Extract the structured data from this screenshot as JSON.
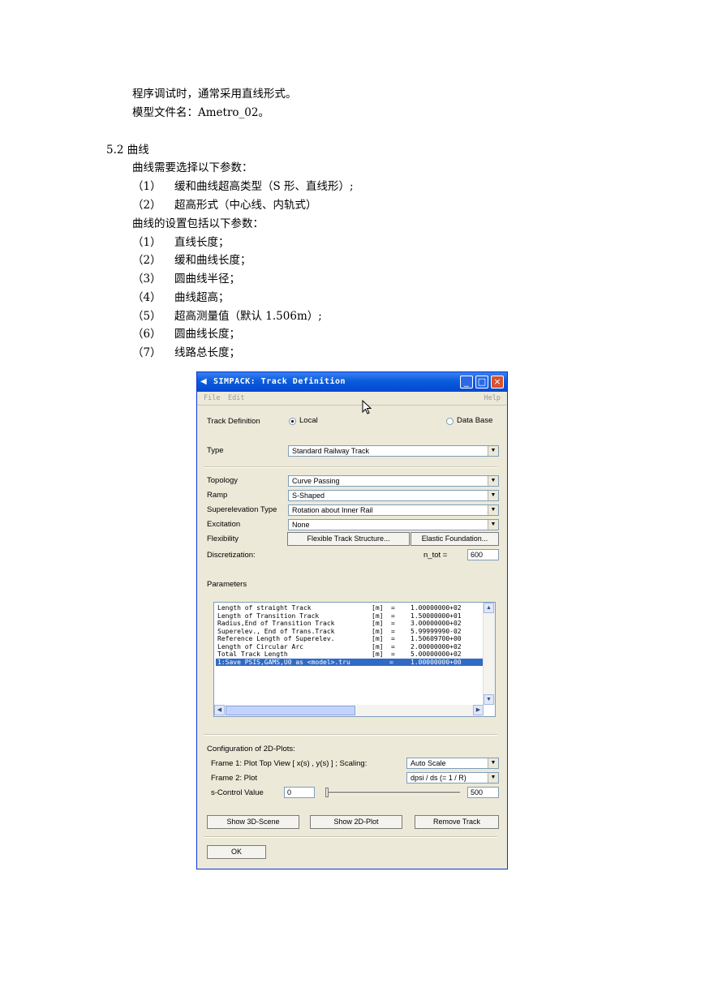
{
  "doc": {
    "line1": "程序调试时，通常采用直线形式。",
    "line2": "模型文件名：Ametro_02。",
    "section": "5.2 曲线",
    "intro1": "曲线需要选择以下参数：",
    "intro1_items": [
      {
        "num": "（1）",
        "text": "缓和曲线超高类型（S 形、直线形）;"
      },
      {
        "num": "（2）",
        "text": "超高形式（中心线、内轨式）"
      }
    ],
    "intro2": "曲线的设置包括以下参数：",
    "intro2_items": [
      {
        "num": "（1）",
        "text": "直线长度；"
      },
      {
        "num": "（2）",
        "text": "缓和曲线长度；"
      },
      {
        "num": "（3）",
        "text": "圆曲线半径；"
      },
      {
        "num": "（4）",
        "text": "曲线超高；"
      },
      {
        "num": "（5）",
        "text": "超高测量值（默认 1.506m）;"
      },
      {
        "num": "（6）",
        "text": "圆曲线长度；"
      },
      {
        "num": "（7）",
        "text": "线路总长度；"
      }
    ]
  },
  "window": {
    "title": "SIMPACK: Track Definition",
    "menu": {
      "file": "File",
      "edit": "Edit",
      "help": "Help"
    },
    "track_definition_label": "Track Definition",
    "radio_local": "Local",
    "radio_database": "Data Base",
    "radio_selected": "Local",
    "type_label": "Type",
    "type_value": "Standard Railway Track",
    "topology_label": "Topology",
    "topology_value": "Curve Passing",
    "ramp_label": "Ramp",
    "ramp_value": "S-Shaped",
    "superelevation_label": "Superelevation Type",
    "superelevation_value": "Rotation about Inner Rail",
    "excitation_label": "Excitation",
    "excitation_value": "None",
    "flexibility_label": "Flexibility",
    "flexible_button": "Flexible Track Structure...",
    "elastic_button": "Elastic Foundation...",
    "discretization_label": "Discretization:",
    "ntot_label": "n_tot =",
    "ntot_value": "600",
    "parameters_label": "Parameters",
    "parameters": [
      {
        "name": "Length of straight Track",
        "unit": "[m]",
        "eq": "=",
        "value": "1.00000000+02"
      },
      {
        "name": "Length of Transition Track",
        "unit": "[m]",
        "eq": "=",
        "value": "1.50000000+01"
      },
      {
        "name": "Radius,End of Transition Track",
        "unit": "[m]",
        "eq": "=",
        "value": "3.00000000+02"
      },
      {
        "name": "Superelev., End of Trans.Track",
        "unit": "[m]",
        "eq": "=",
        "value": "5.99999990-02"
      },
      {
        "name": "Reference Length of Superelev.",
        "unit": "[m]",
        "eq": "=",
        "value": "1.50609700+00"
      },
      {
        "name": "Length of Circular Arc",
        "unit": "[m]",
        "eq": "=",
        "value": "2.00000000+02"
      },
      {
        "name": "Total Track Length",
        "unit": "[m]",
        "eq": "=",
        "value": "5.00000000+02"
      },
      {
        "name": "1:Save PSIS,GAMS,U0 as <model>.tru",
        "unit": "",
        "eq": "=",
        "value": "1.00000000+00",
        "selected": true
      }
    ],
    "config_label": "Configuration of 2D-Plots:",
    "frame1_label": "Frame 1:  Plot Top View [ x(s) , y(s) ] ;   Scaling:",
    "scaling_value": "Auto Scale",
    "frame2_label": "Frame 2:  Plot",
    "frame2_value": "dpsi / ds  (= 1 / R)",
    "scontrol_label": "s-Control Value",
    "scontrol_value": "0",
    "scontrol_max": "500",
    "show3d_button": "Show 3D-Scene",
    "show2d_button": "Show 2D-Plot",
    "remove_button": "Remove Track",
    "ok_button": "OK"
  }
}
